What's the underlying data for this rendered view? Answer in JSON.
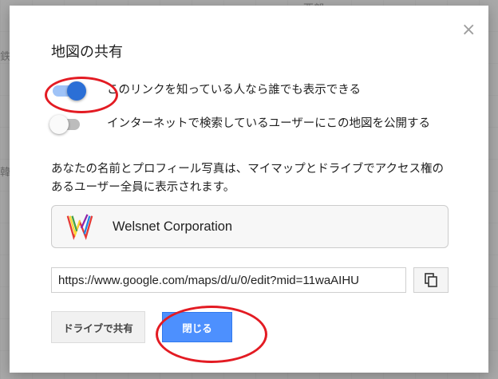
{
  "map": {
    "label_top": "西部",
    "label_left1": "鉄",
    "label_left2": "韓"
  },
  "dialog": {
    "title": "地図の共有",
    "close_symbol": "×",
    "toggle_public_link": {
      "label": "このリンクを知っている人なら誰でも表示できる",
      "state": "on"
    },
    "toggle_searchable": {
      "label": "インターネットで検索しているユーザーにこの地図を公開する",
      "state": "off"
    },
    "description": "あなたの名前とプロフィール写真は、マイマップとドライブでアクセス権のあるユーザー全員に表示されます。",
    "organization": {
      "name": "Welsnet Corporation",
      "logo_icon": "welsnet-logo"
    },
    "share_url": "https://www.google.com/maps/d/u/0/edit?mid=11waAIHU",
    "copy_icon": "copy-icon",
    "drive_share_button": "ドライブで共有",
    "close_button": "閉じる"
  },
  "colors": {
    "accent": "#4d90fe",
    "toggle_on": "#2b6fd6",
    "annotation": "#e31b23"
  }
}
